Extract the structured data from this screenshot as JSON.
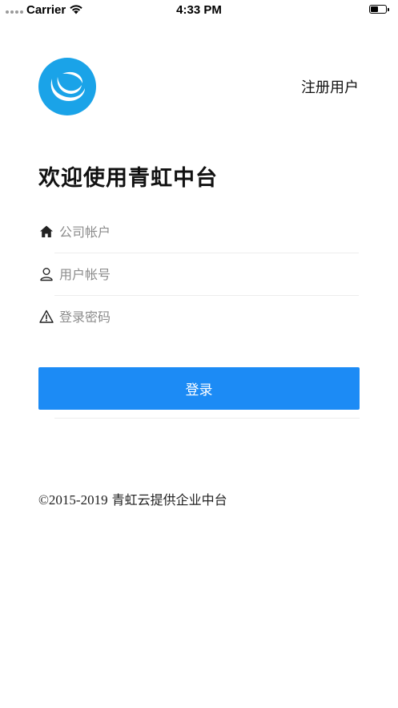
{
  "status_bar": {
    "carrier": "Carrier",
    "time": "4:33 PM"
  },
  "header": {
    "logo_icon": "qinghong-cloud-logo",
    "register_label": "注册用户",
    "welcome_title": "欢迎使用青虹中台"
  },
  "form": {
    "company": {
      "icon": "home-icon",
      "value": "",
      "placeholder": "公司帐户"
    },
    "username": {
      "icon": "user-icon",
      "value": "",
      "placeholder": "用户帐号"
    },
    "password": {
      "icon": "warning-icon",
      "value": "",
      "placeholder": "登录密码"
    },
    "login_label": "登录"
  },
  "footer": {
    "copyright_year": "©2015-2019",
    "copyright_text": "青虹云提供企业中台"
  },
  "colors": {
    "primary": "#1c8bf5",
    "logo": "#1aa3e8",
    "divider": "#ececec"
  }
}
